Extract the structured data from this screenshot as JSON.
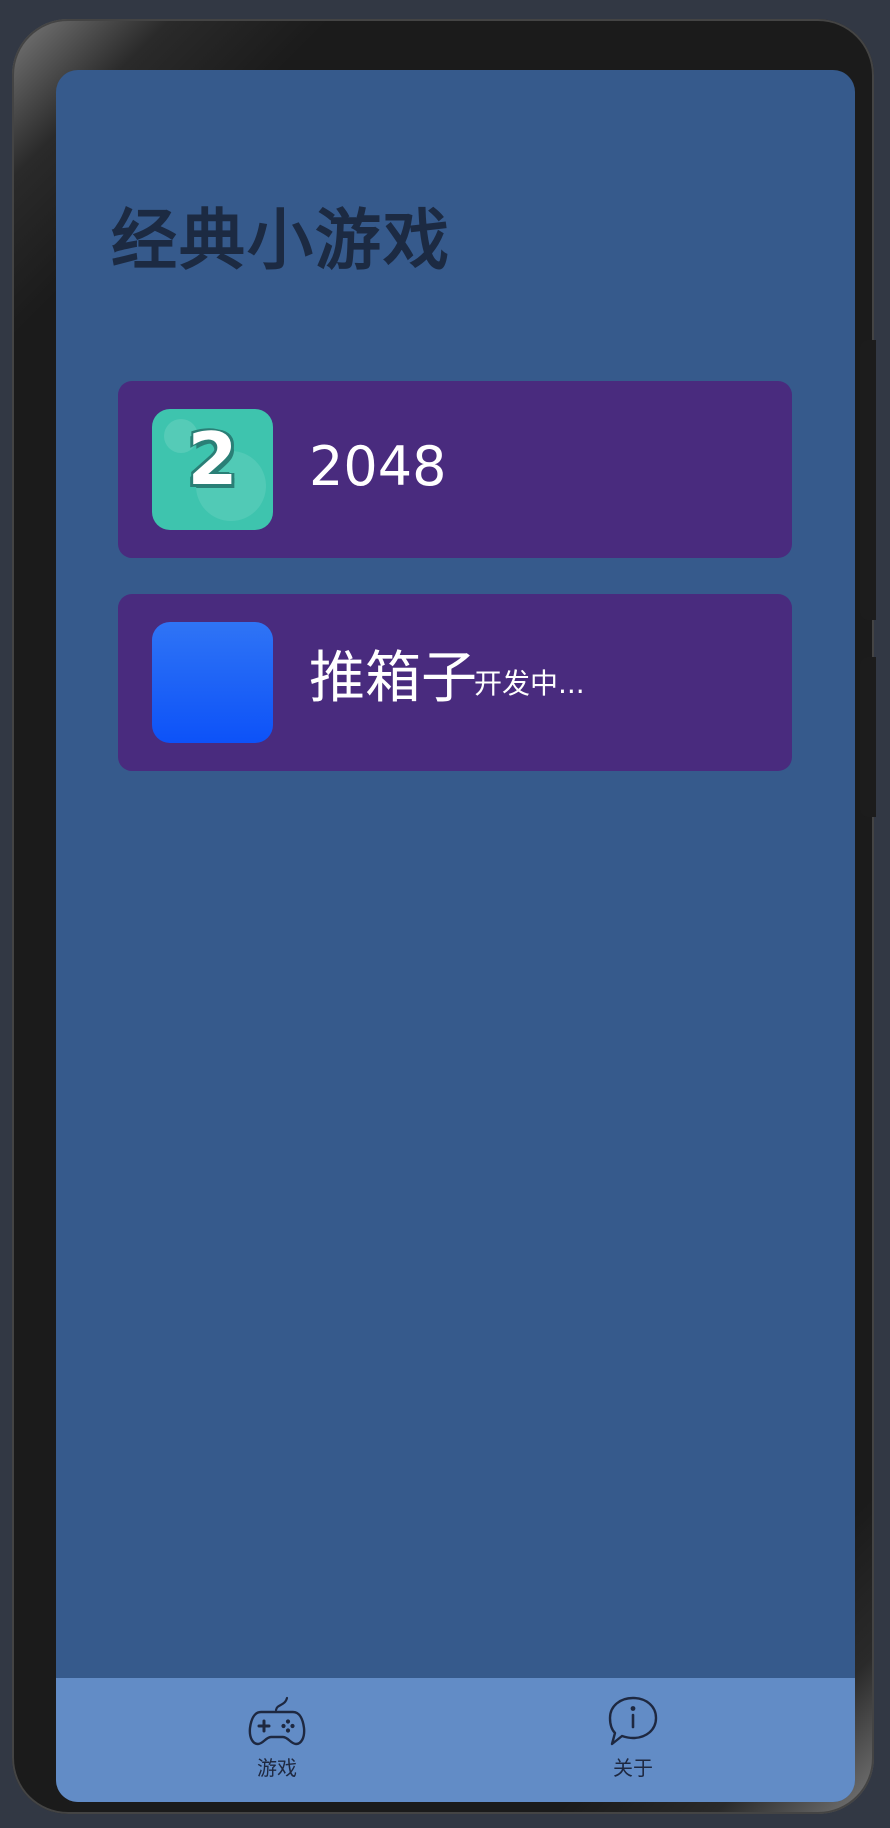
{
  "header": {
    "title": "经典小游戏"
  },
  "games": [
    {
      "name": "2048",
      "icon": "game-2048-icon",
      "icon_glyph": "2",
      "status": ""
    },
    {
      "name": "推箱子",
      "icon": "sokoban-icon",
      "status": "开发中..."
    }
  ],
  "tabbar": {
    "tabs": [
      {
        "label": "游戏",
        "icon": "gamepad-icon"
      },
      {
        "label": "关于",
        "icon": "info-bubble-icon"
      }
    ]
  },
  "colors": {
    "screen_background": "#365a8c",
    "card_background": "#492b7e",
    "tabbar_background": "#628cc6",
    "title_text": "#1c2a42",
    "icon_2048_background": "#3ec4ae",
    "icon_sokoban_background": "#1a5ff7"
  }
}
